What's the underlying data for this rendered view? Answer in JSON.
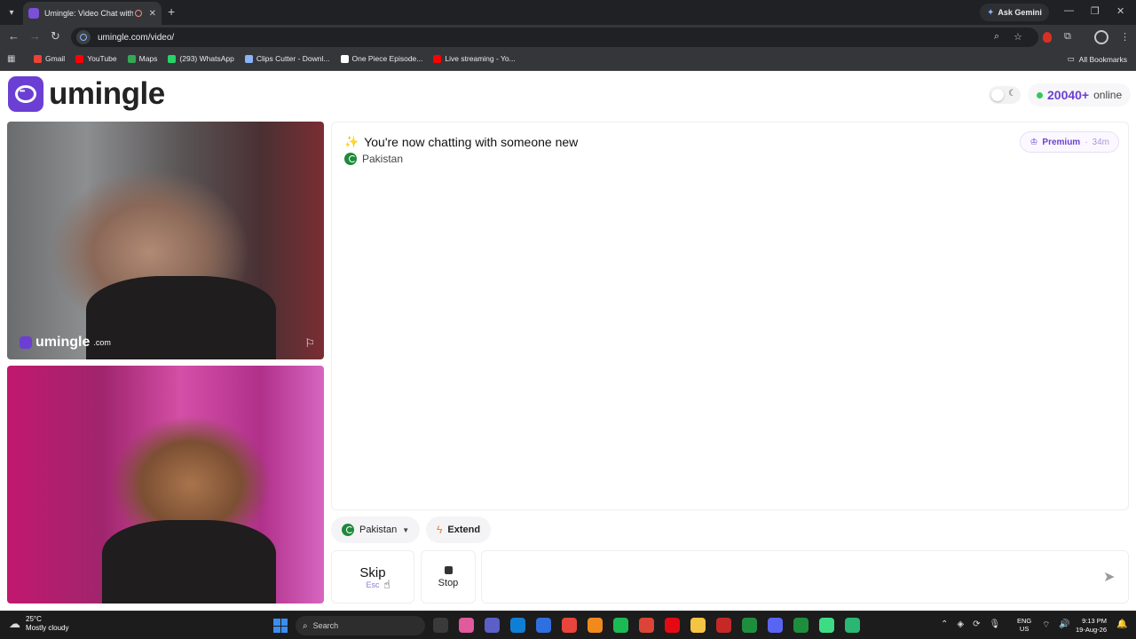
{
  "browser": {
    "tab_title": "Umingle: Video Chat with St",
    "new_tab_icon": "plus-icon",
    "ask_gemini": "Ask Gemini",
    "url": "umingle.com/video/",
    "bookmarks": [
      {
        "label": "Gmail",
        "color": "#ea4335"
      },
      {
        "label": "YouTube",
        "color": "#ff0000"
      },
      {
        "label": "Maps",
        "color": "#34a853"
      },
      {
        "label": "(293) WhatsApp",
        "color": "#25d366"
      },
      {
        "label": "Clips Cutter - Downl...",
        "color": "#8ab4f8"
      },
      {
        "label": "One Piece Episode...",
        "color": "#ffffff"
      },
      {
        "label": "Live streaming - Yo...",
        "color": "#ff0000"
      }
    ],
    "all_bookmarks": "All Bookmarks"
  },
  "header": {
    "logo_text": "umingle",
    "online_count": "20040+",
    "online_label": "online",
    "accent_color": "#6b3fd4",
    "online_dot_color": "#34c759"
  },
  "video": {
    "watermark": "umingle",
    "watermark_suffix": ".com"
  },
  "chat": {
    "headline": "You're now chatting with someone new",
    "country": "Pakistan",
    "premium_label": "Premium",
    "premium_sep": "·",
    "premium_time": "34m"
  },
  "controls": {
    "country_filter": "Pakistan",
    "extend": "Extend",
    "skip": "Skip",
    "skip_key": "Esc",
    "stop": "Stop",
    "message_placeholder": ""
  },
  "taskbar": {
    "temperature": "25°C",
    "weather": "Mostly cloudy",
    "search": "Search",
    "lang_top": "ENG",
    "lang_bottom": "US",
    "time": "9:13 PM",
    "date": "19-Aug-26",
    "app_colors": [
      "#3a3a3a",
      "#e05a9c",
      "#5b5fc7",
      "#0f7fd6",
      "#2f6fe0",
      "#e8453c",
      "#f08a1c",
      "#1db954",
      "#db4437",
      "#e50914",
      "#f4c542",
      "#c62828",
      "#1e8e3e",
      "#5865f2",
      "#1e8e3e",
      "#3ddc84",
      "#2bb673"
    ]
  }
}
